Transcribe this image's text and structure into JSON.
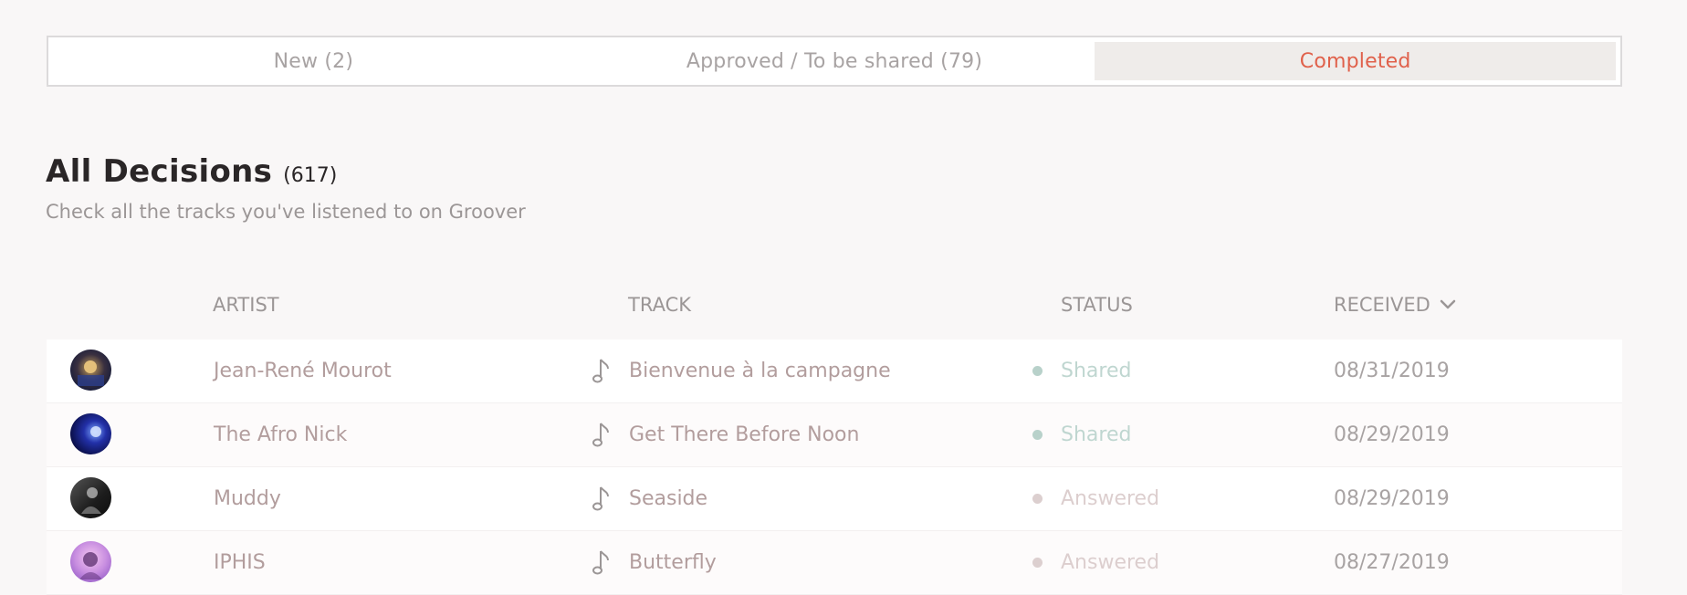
{
  "tabs": [
    {
      "label": "New (2)",
      "active": false
    },
    {
      "label": "Approved / To be shared (79)",
      "active": false
    },
    {
      "label": "Completed",
      "active": true
    }
  ],
  "section": {
    "title": "All Decisions",
    "count": "(617)",
    "subtitle": "Check all the tracks you've listened to on Groover"
  },
  "table": {
    "headers": {
      "artist": "ARTIST",
      "track": "TRACK",
      "status": "STATUS",
      "received": "RECEIVED"
    },
    "rows": [
      {
        "artist": "Jean-René Mourot",
        "track": "Bienvenue à la campagne",
        "status": "Shared",
        "received": "08/31/2019",
        "dot_color": "#b8d1ca"
      },
      {
        "artist": "The Afro Nick",
        "track": "Get There Before Noon",
        "status": "Shared",
        "received": "08/29/2019",
        "dot_color": "#b8d1ca"
      },
      {
        "artist": "Muddy",
        "track": "Seaside",
        "status": "Answered",
        "received": "08/29/2019",
        "dot_color": "#dccfcf"
      },
      {
        "artist": "IPHIS",
        "track": "Butterfly",
        "status": "Answered",
        "received": "08/27/2019",
        "dot_color": "#dccfcf"
      }
    ]
  },
  "colors": {
    "accent": "#e0614b",
    "background": "#f9f7f7"
  }
}
